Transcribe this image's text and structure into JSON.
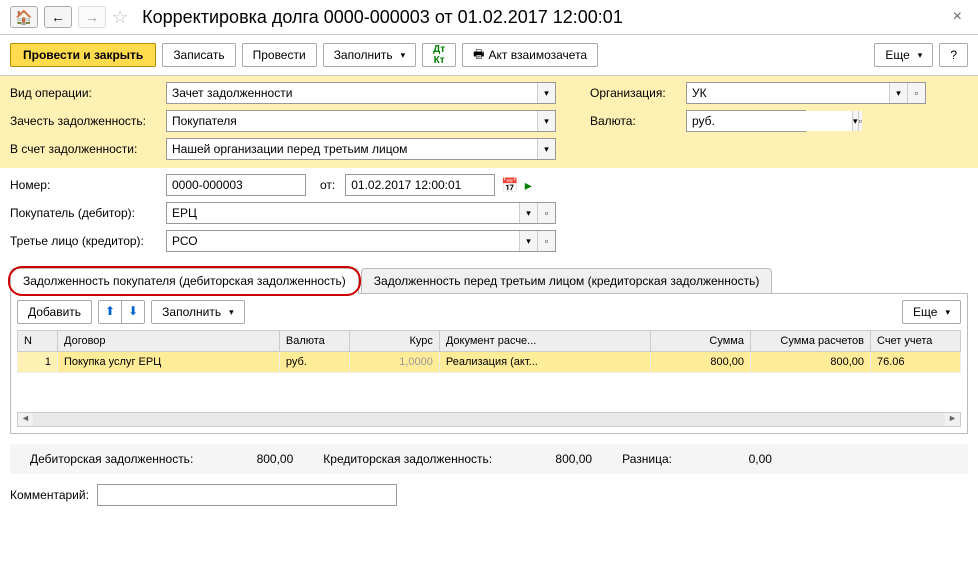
{
  "topbar": {
    "title": "Корректировка долга 0000-000003 от 01.02.2017 12:00:01"
  },
  "toolbar": {
    "post_close": "Провести и закрыть",
    "save": "Записать",
    "post": "Провести",
    "fill": "Заполнить",
    "act": "Акт взаимозачета",
    "more": "Еще"
  },
  "fields": {
    "operation_label": "Вид операции:",
    "operation_value": "Зачет задолженности",
    "offset_label": "Зачесть задолженность:",
    "offset_value": "Покупателя",
    "against_label": "В счет задолженности:",
    "against_value": "Нашей организации перед третьим лицом",
    "org_label": "Организация:",
    "org_value": "УК",
    "currency_label": "Валюта:",
    "currency_value": "руб.",
    "number_label": "Номер:",
    "number_value": "0000-000003",
    "from_label": "от:",
    "date_value": "01.02.2017 12:00:01",
    "buyer_label": "Покупатель (дебитор):",
    "buyer_value": "ЕРЦ",
    "third_label": "Третье лицо (кредитор):",
    "third_value": "РСО"
  },
  "tabs": {
    "t1": "Задолженность покупателя (дебиторская задолженность)",
    "t2": "Задолженность перед третьим лицом (кредиторская задолженность)"
  },
  "tabtoolbar": {
    "add": "Добавить",
    "fill": "Заполнить",
    "more": "Еще"
  },
  "table": {
    "headers": {
      "n": "N",
      "contract": "Договор",
      "currency": "Валюта",
      "rate": "Курс",
      "doc": "Документ расче...",
      "sum": "Сумма",
      "sum_calc": "Сумма расчетов",
      "account": "Счет учета"
    },
    "rows": [
      {
        "n": "1",
        "contract": "Покупка услуг ЕРЦ",
        "currency": "руб.",
        "rate": "1,0000",
        "doc": "Реализация (акт...",
        "sum": "800,00",
        "sum_calc": "800,00",
        "account": "76.06"
      }
    ]
  },
  "summary": {
    "debit_label": "Дебиторская задолженность:",
    "debit_value": "800,00",
    "credit_label": "Кредиторская задолженность:",
    "credit_value": "800,00",
    "diff_label": "Разница:",
    "diff_value": "0,00"
  },
  "comment": {
    "label": "Комментарий:",
    "value": ""
  }
}
